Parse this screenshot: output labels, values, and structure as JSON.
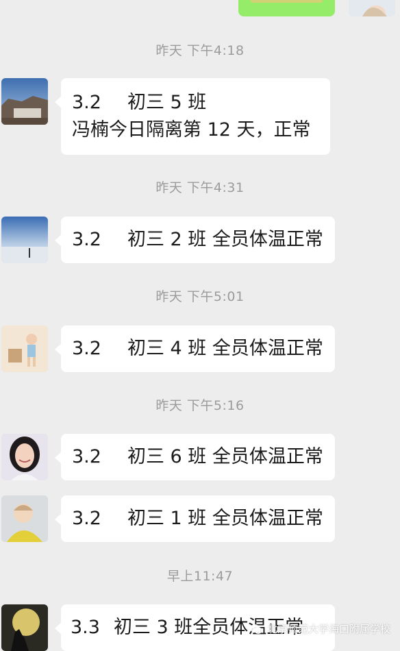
{
  "colors": {
    "background": "#ededed",
    "bubble": "#ffffff",
    "sent_bubble": "#95ec69",
    "timestamp_text": "#9b9b9b"
  },
  "timestamps": [
    "昨天 下午4:18",
    "昨天 下午4:31",
    "昨天 下午5:01",
    "昨天 下午5:16",
    "早上11:47"
  ],
  "messages": [
    {
      "date": "3.2",
      "text": "初三 5 班",
      "line2": "冯楠今日隔离第 12 天，正常"
    },
    {
      "date": "3.2",
      "text": "初三 2 班 全员体温正常"
    },
    {
      "date": "3.2",
      "text": "初三 4 班 全员体温正常"
    },
    {
      "date": "3.2",
      "text": "初三 6 班 全员体温正常"
    },
    {
      "date": "3.2",
      "text": "初三 1 班 全员体温正常"
    },
    {
      "date": "3.3",
      "text": "初三 3 班全员体温正常"
    }
  ],
  "watermark": "北京师范大学海口附属学校"
}
